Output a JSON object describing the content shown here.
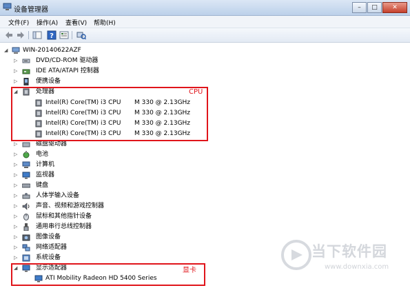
{
  "window": {
    "title": "设备管理器",
    "buttons": {
      "minimize": "–",
      "maximize": "□",
      "close": "✕"
    }
  },
  "menu": [
    {
      "label": "文件(F)"
    },
    {
      "label": "操作(A)"
    },
    {
      "label": "查看(V)"
    },
    {
      "label": "帮助(H)"
    }
  ],
  "tree": {
    "root": "WIN-20140622AZF",
    "before_cpu": [
      {
        "label": "DVD/CD-ROM 驱动器",
        "icon": "dvd-drive-icon"
      },
      {
        "label": "IDE ATA/ATAPI 控制器",
        "icon": "ide-controller-icon"
      },
      {
        "label": "便携设备",
        "icon": "portable-device-icon"
      }
    ],
    "processors": {
      "label": "处理器",
      "children": [
        {
          "name": "Intel(R) Core(TM) i3 CPU",
          "spec": "M 330  @ 2.13GHz"
        },
        {
          "name": "Intel(R) Core(TM) i3 CPU",
          "spec": "M 330  @ 2.13GHz"
        },
        {
          "name": "Intel(R) Core(TM) i3 CPU",
          "spec": "M 330  @ 2.13GHz"
        },
        {
          "name": "Intel(R) Core(TM) i3 CPU",
          "spec": "M 330  @ 2.13GHz"
        }
      ]
    },
    "after_cpu": [
      {
        "label": "磁盘驱动器",
        "icon": "disk-drive-icon"
      },
      {
        "label": "电池",
        "icon": "battery-icon"
      },
      {
        "label": "计算机",
        "icon": "computer-icon"
      },
      {
        "label": "监视器",
        "icon": "monitor-icon"
      },
      {
        "label": "键盘",
        "icon": "keyboard-icon"
      },
      {
        "label": "人体学输入设备",
        "icon": "hid-icon"
      },
      {
        "label": "声音、视频和游戏控制器",
        "icon": "sound-icon"
      },
      {
        "label": "鼠标和其他指针设备",
        "icon": "mouse-icon"
      },
      {
        "label": "通用串行总线控制器",
        "icon": "usb-icon"
      },
      {
        "label": "图像设备",
        "icon": "imaging-icon"
      },
      {
        "label": "网络适配器",
        "icon": "network-icon"
      },
      {
        "label": "系统设备",
        "icon": "system-device-icon"
      }
    ],
    "display": {
      "label": "显示适配器",
      "children": [
        {
          "name": "ATI Mobility Radeon HD 5400 Series"
        }
      ]
    }
  },
  "annotations": {
    "cpu": "CPU",
    "display": "显卡"
  },
  "watermark": {
    "brand": "当下软件园",
    "url": "www.downxia.com"
  },
  "colors": {
    "highlight": "#e0141a"
  }
}
